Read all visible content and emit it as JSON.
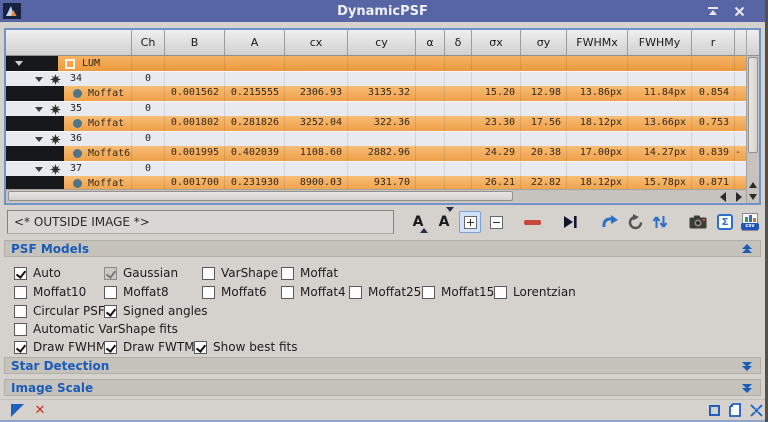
{
  "window": {
    "title": "DynamicPSF"
  },
  "table": {
    "columns": [
      "",
      "Ch",
      "B",
      "A",
      "cx",
      "cy",
      "α",
      "δ",
      "σx",
      "σy",
      "FWHMx",
      "FWHMy",
      "r"
    ],
    "rows": [
      {
        "type": "group",
        "label": "LUM"
      },
      {
        "type": "star",
        "id": "34",
        "ch": "0"
      },
      {
        "type": "fit",
        "model": "Moffat",
        "b": "0.001562",
        "a": "0.215555",
        "cx": "2306.93",
        "cy": "3135.32",
        "sx": "15.20",
        "sy": "12.98",
        "fwhmx": "13.86px",
        "fwhmy": "11.84px",
        "r": "0.854",
        "extra": ""
      },
      {
        "type": "star",
        "id": "35",
        "ch": "0"
      },
      {
        "type": "fit",
        "model": "Moffat",
        "b": "0.001802",
        "a": "0.281826",
        "cx": "3252.04",
        "cy": "322.36",
        "sx": "23.30",
        "sy": "17.56",
        "fwhmx": "18.12px",
        "fwhmy": "13.66px",
        "r": "0.753",
        "extra": ""
      },
      {
        "type": "star",
        "id": "36",
        "ch": "0"
      },
      {
        "type": "fit",
        "model": "Moffat6",
        "b": "0.001995",
        "a": "0.402039",
        "cx": "1108.60",
        "cy": "2882.96",
        "sx": "24.29",
        "sy": "20.38",
        "fwhmx": "17.00px",
        "fwhmy": "14.27px",
        "r": "0.839",
        "extra": "-"
      },
      {
        "type": "star",
        "id": "37",
        "ch": "0"
      },
      {
        "type": "fit",
        "model": "Moffat",
        "b": "0.001700",
        "a": "0.231930",
        "cx": "8900.03",
        "cy": "931.70",
        "sx": "26.21",
        "sy": "22.82",
        "fwhmx": "18.12px",
        "fwhmy": "15.78px",
        "r": "0.871",
        "extra": ""
      }
    ]
  },
  "selector": {
    "value": "<* OUTSIDE IMAGE *>"
  },
  "icons": {
    "font_letter": "A",
    "sigma": "Σ",
    "csv_label": "csv",
    "close": "✕",
    "redx": "✕"
  },
  "colors": {
    "titlebar": "#5765a5",
    "row_orange": "#f2a855",
    "row_light": "#e9e9f0",
    "section_text": "#1b5cb8",
    "accent_blue": "#2e6fc9",
    "delete_red": "#c4473a"
  },
  "psf_models": {
    "title": "PSF Models",
    "rows": [
      {
        "items": [
          {
            "label": "Auto",
            "checked": true,
            "disabled": false
          },
          {
            "label": "Gaussian",
            "checked": true,
            "disabled": true
          },
          {
            "label": "VarShape",
            "checked": false,
            "disabled": false
          },
          {
            "label": "Moffat",
            "checked": false,
            "disabled": false
          }
        ]
      },
      {
        "items": [
          {
            "label": "Moffat10",
            "checked": false,
            "disabled": false
          },
          {
            "label": "Moffat8",
            "checked": false,
            "disabled": false
          },
          {
            "label": "Moffat6",
            "checked": false,
            "disabled": false
          },
          {
            "label": "Moffat4",
            "checked": false,
            "disabled": false
          },
          {
            "label": "Moffat25",
            "checked": false,
            "disabled": false
          },
          {
            "label": "Moffat15",
            "checked": false,
            "disabled": false
          },
          {
            "label": "Lorentzian",
            "checked": false,
            "disabled": false
          }
        ]
      },
      {
        "items": [
          {
            "label": "Circular PSF",
            "checked": false,
            "disabled": false
          },
          {
            "label": "Signed angles",
            "checked": true,
            "disabled": false
          }
        ]
      },
      {
        "items": [
          {
            "label": "Automatic VarShape fits",
            "checked": false,
            "disabled": false
          }
        ]
      },
      {
        "items": [
          {
            "label": "Draw FWHM",
            "checked": true,
            "disabled": false
          },
          {
            "label": "Draw FWTM",
            "checked": true,
            "disabled": false
          },
          {
            "label": "Show best fits",
            "checked": true,
            "disabled": false
          }
        ]
      }
    ]
  },
  "sections": {
    "star_detection": "Star Detection",
    "image_scale": "Image Scale"
  }
}
